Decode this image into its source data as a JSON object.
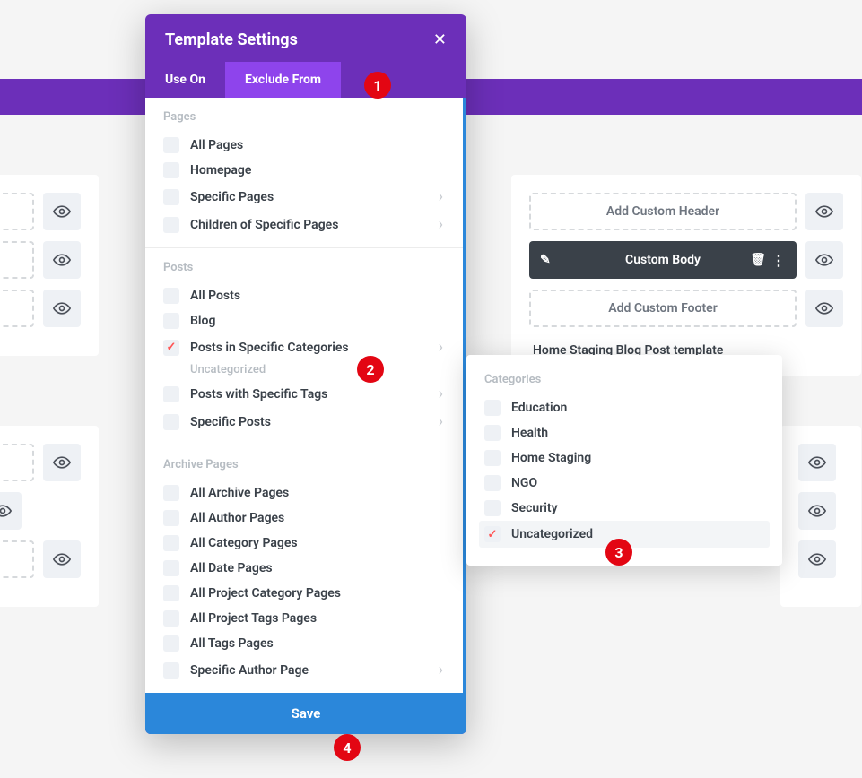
{
  "modal": {
    "title": "Template Settings",
    "tabs": {
      "useOn": "Use On",
      "excludeFrom": "Exclude From"
    },
    "save": "Save",
    "sections": {
      "pages": {
        "title": "Pages",
        "items": {
          "allPages": "All Pages",
          "homepage": "Homepage",
          "specificPages": "Specific Pages",
          "childrenPages": "Children of Specific Pages"
        }
      },
      "posts": {
        "title": "Posts",
        "items": {
          "allPosts": "All Posts",
          "blog": "Blog",
          "postsInCat": "Posts in Specific Categories",
          "postsInCatSub": "Uncategorized",
          "postsTags": "Posts with Specific Tags",
          "specificPosts": "Specific Posts"
        }
      },
      "archive": {
        "title": "Archive Pages",
        "items": {
          "allArchive": "All Archive Pages",
          "allAuthor": "All Author Pages",
          "allCategory": "All Category Pages",
          "allDate": "All Date Pages",
          "allProjCat": "All Project Category Pages",
          "allProjTags": "All Project Tags Pages",
          "allTags": "All Tags Pages",
          "specificAuthor": "Specific Author Page"
        }
      }
    }
  },
  "annotations": {
    "a1": "1",
    "a2": "2",
    "a3": "3",
    "a4": "4"
  },
  "categories": {
    "title": "Categories",
    "items": {
      "education": "Education",
      "health": "Health",
      "homeStaging": "Home Staging",
      "ngo": "NGO",
      "security": "Security",
      "uncat": "Uncategorized"
    },
    "tooltip": "uncategorized"
  },
  "background": {
    "addHeader": "Add Custom Header",
    "customBody": "Custom Body",
    "addFooter": "Add Custom Footer",
    "templateName": "Home Staging Blog Post template"
  }
}
